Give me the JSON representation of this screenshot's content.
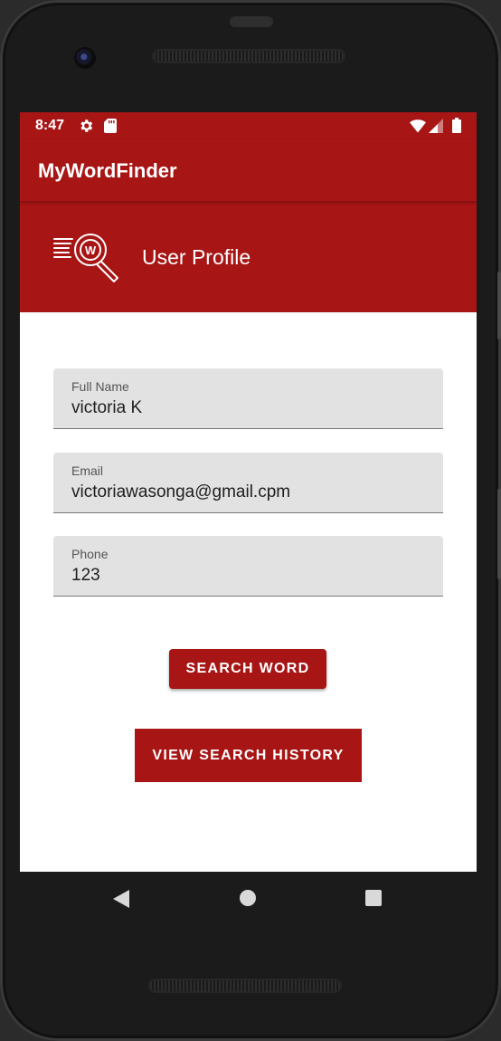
{
  "status_bar": {
    "time": "8:47",
    "icons": [
      "gear-icon",
      "sd-card-icon",
      "wifi-icon",
      "signal-icon",
      "battery-icon"
    ]
  },
  "app_bar": {
    "title": "MyWordFinder"
  },
  "header": {
    "title": "User Profile",
    "logo": "word-search-logo-icon"
  },
  "form": {
    "full_name": {
      "label": "Full Name",
      "value": "victoria K"
    },
    "email": {
      "label": "Email",
      "value": "victoriawasonga@gmail.cpm"
    },
    "phone": {
      "label": "Phone",
      "value": "123"
    }
  },
  "buttons": {
    "search_word": "SEARCH WORD",
    "view_history": "VIEW SEARCH HISTORY"
  },
  "nav_bar": {
    "icons": [
      "back-icon",
      "home-icon",
      "recent-apps-icon"
    ]
  },
  "colors": {
    "primary": "#a71515",
    "field_background": "#e2e2e2",
    "screen_background": "#ffffff"
  }
}
